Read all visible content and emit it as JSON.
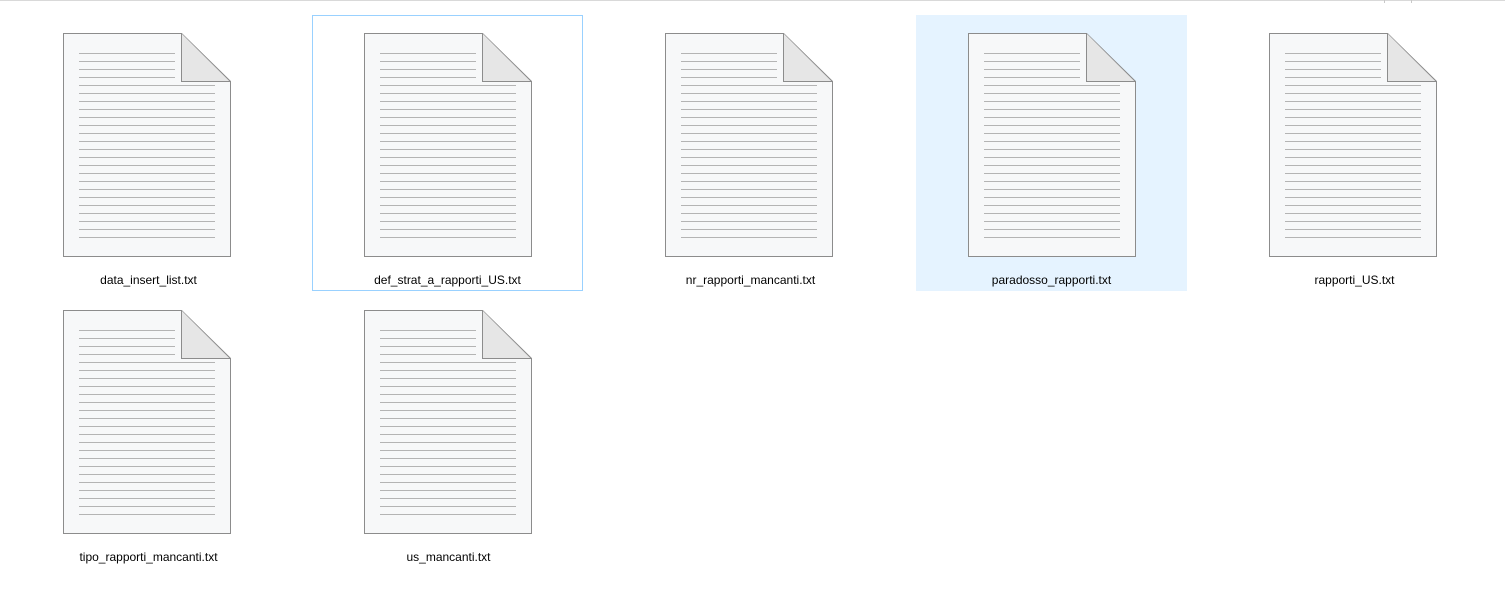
{
  "files": [
    {
      "name": "data_insert_list.txt",
      "icon": "text-file-icon",
      "state": "normal"
    },
    {
      "name": "def_strat_a_rapporti_US.txt",
      "icon": "text-file-icon",
      "state": "focused"
    },
    {
      "name": "nr_rapporti_mancanti.txt",
      "icon": "text-file-icon",
      "state": "normal"
    },
    {
      "name": "paradosso_rapporti.txt",
      "icon": "text-file-icon",
      "state": "selected"
    },
    {
      "name": "rapporti_US.txt",
      "icon": "text-file-icon",
      "state": "normal"
    },
    {
      "name": "tipo_rapporti_mancanti.txt",
      "icon": "text-file-icon",
      "state": "normal"
    },
    {
      "name": "us_mancanti.txt",
      "icon": "text-file-icon",
      "state": "normal"
    }
  ],
  "colors": {
    "selection_background": "#e5f3ff",
    "focus_border": "#99d1ff",
    "icon_page": "#f7f8f9",
    "icon_outline": "#8c8c8c",
    "icon_lines": "#b4b4b4"
  }
}
